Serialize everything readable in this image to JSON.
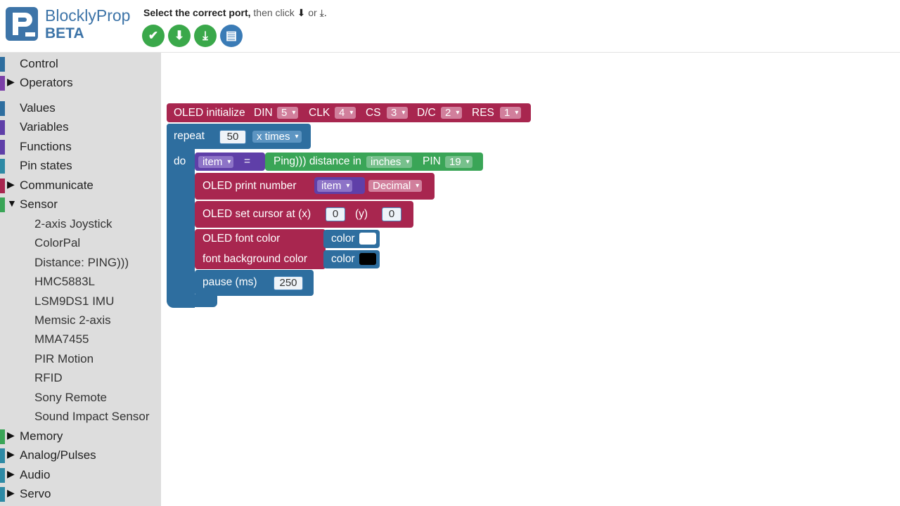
{
  "header": {
    "brand_name": "BlocklyProp",
    "brand_badge": "BETA",
    "instruction_bold": "Select the correct port,",
    "instruction_rest": "then click",
    "instruction_or": "or",
    "toolbar": [
      {
        "name": "compile-button",
        "icon": "check-icon",
        "glyph": "✔"
      },
      {
        "name": "load-ram-button",
        "icon": "download-arrow-icon",
        "glyph": "⬇"
      },
      {
        "name": "load-eeprom-button",
        "icon": "download-tray-icon",
        "glyph": "⤓"
      },
      {
        "name": "serial-terminal-button",
        "icon": "terminal-icon",
        "glyph": "▤"
      }
    ]
  },
  "colors": {
    "oled": "#a8264f",
    "loop": "#2e6e9f",
    "sensor": "#3aa557",
    "variable": "#5f3fa8"
  },
  "sidebar": {
    "categories": [
      {
        "label": "Control",
        "color": "#2e6e9f",
        "expandable": false
      },
      {
        "label": "Operators",
        "color": "#7b3fa8",
        "expandable": true
      },
      {
        "label": "Values",
        "color": "#2e6e9f",
        "expandable": false
      },
      {
        "label": "Variables",
        "color": "#5f3fa8",
        "expandable": false
      },
      {
        "label": "Functions",
        "color": "#5f3fa8",
        "expandable": false
      },
      {
        "label": "Pin states",
        "color": "#2e8aa5",
        "expandable": false
      },
      {
        "label": "Communicate",
        "color": "#a8264f",
        "expandable": true
      },
      {
        "label": "Sensor",
        "color": "#3aa557",
        "expandable": true,
        "expanded": true
      },
      {
        "label": "Memory",
        "color": "#3aa557",
        "expandable": true
      },
      {
        "label": "Analog/Pulses",
        "color": "#2e8aa5",
        "expandable": true
      },
      {
        "label": "Audio",
        "color": "#2e8aa5",
        "expandable": true
      },
      {
        "label": "Servo",
        "color": "#2e8aa5",
        "expandable": true
      }
    ],
    "sensor_items": [
      "2-axis Joystick",
      "ColorPal",
      "Distance: PING)))",
      "HMC5883L",
      "LSM9DS1 IMU",
      "Memsic 2-axis",
      "MMA7455",
      "PIR Motion",
      "RFID",
      "Sony Remote",
      "Sound Impact Sensor"
    ]
  },
  "workspace": {
    "oled_init": {
      "label": "OLED initialize",
      "din_label": "DIN",
      "din": "5",
      "clk_label": "CLK",
      "clk": "4",
      "cs_label": "CS",
      "cs": "3",
      "dc_label": "D/C",
      "dc": "2",
      "res_label": "RES",
      "res": "1"
    },
    "repeat": {
      "label": "repeat",
      "count": "50",
      "mode": "x times",
      "do_label": "do"
    },
    "assign": {
      "var": "item",
      "eq": "=",
      "sensor_label": "Ping))) distance in",
      "unit": "inches",
      "pin_label": "PIN",
      "pin": "19"
    },
    "print_number": {
      "label": "OLED print number",
      "var": "item",
      "format": "Decimal"
    },
    "set_cursor": {
      "label": "OLED set cursor at (x)",
      "x": "0",
      "y_label": "(y)",
      "y": "0"
    },
    "font_color": {
      "label": "OLED font color",
      "color_label": "color",
      "color": "#ffffff",
      "bg_label": "font background color",
      "bg_color_label": "color",
      "bg_color": "#000000"
    },
    "pause": {
      "label": "pause (ms)",
      "value": "250"
    }
  }
}
